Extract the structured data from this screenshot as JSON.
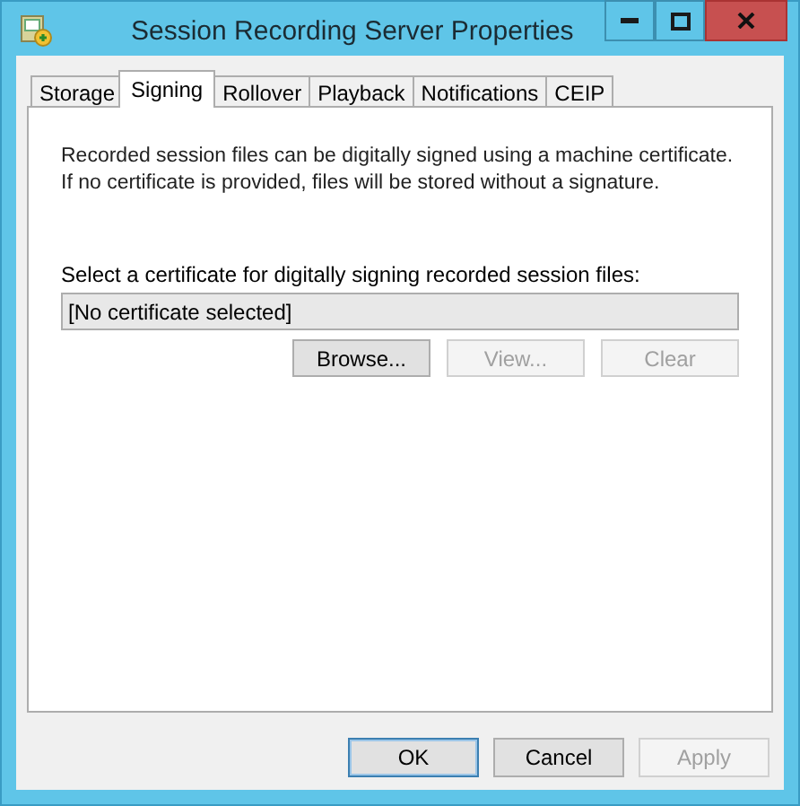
{
  "window": {
    "title": "Session Recording Server Properties"
  },
  "tabs": [
    {
      "label": "Storage",
      "selected": false
    },
    {
      "label": "Signing",
      "selected": true
    },
    {
      "label": "Rollover",
      "selected": false
    },
    {
      "label": "Playback",
      "selected": false
    },
    {
      "label": "Notifications",
      "selected": false
    },
    {
      "label": "CEIP",
      "selected": false
    }
  ],
  "description": [
    "Recorded session files can be digitally signed using a machine certificate.",
    "If no certificate is provided, files will be stored without a signature."
  ],
  "certificate": {
    "label": "Select a certificate for digitally signing recorded session files:",
    "value": "[No certificate selected]"
  },
  "certificate_buttons": [
    {
      "label": "Browse...",
      "disabled": false
    },
    {
      "label": "View...",
      "disabled": true
    },
    {
      "label": "Clear",
      "disabled": true
    }
  ],
  "dialog_buttons": [
    {
      "label": "OK",
      "disabled": false,
      "default": true
    },
    {
      "label": "Cancel",
      "disabled": false,
      "default": false
    },
    {
      "label": "Apply",
      "disabled": true,
      "default": false
    }
  ]
}
